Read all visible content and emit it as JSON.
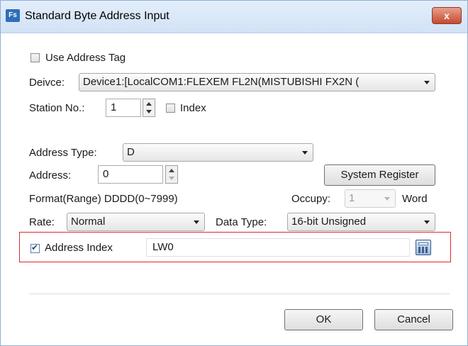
{
  "window": {
    "title": "Standard Byte Address Input",
    "app_icon_text": "Fs",
    "close_symbol": "x"
  },
  "use_address_tag": {
    "label": "Use Address Tag",
    "checked": false
  },
  "device": {
    "label": "Deivce:",
    "value": "Device1:[LocalCOM1:FLEXEM FL2N(MISTUBISHI FX2N ("
  },
  "station": {
    "label": "Station No.:",
    "value": "1",
    "index_label": "Index",
    "index_checked": false
  },
  "address_type": {
    "label": "Address Type:",
    "value": "D"
  },
  "address": {
    "label": "Address:",
    "value": "0"
  },
  "system_register_button": "System Register",
  "format": {
    "text": "Format(Range) DDDD(0~7999)"
  },
  "occupy": {
    "label": "Occupy:",
    "value": "1",
    "unit": "Word"
  },
  "rate": {
    "label": "Rate:",
    "value": "Normal"
  },
  "data_type": {
    "label": "Data Type:",
    "value": "16-bit Unsigned"
  },
  "address_index": {
    "label": "Address Index",
    "checked": true,
    "value": "LW0"
  },
  "buttons": {
    "ok": "OK",
    "cancel": "Cancel"
  },
  "colors": {
    "highlight": "#e0262d",
    "titlebar": "#d2e2f5"
  }
}
